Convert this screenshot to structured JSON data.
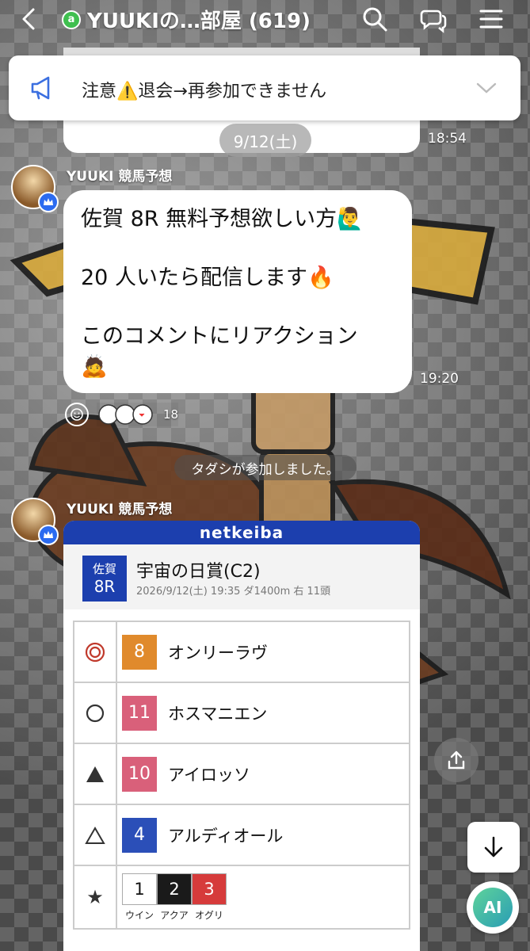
{
  "header": {
    "title": "YUUKIの…部屋 (619)",
    "badge_icon": "chat-room-icon"
  },
  "notice": {
    "text": "注意⚠️退会→再参加できません",
    "icon": "megaphone-icon"
  },
  "date_separator": "9/12(土)",
  "prev_message_time": "18:54",
  "message1": {
    "sender": "YUUKI 競馬予想",
    "line1": "佐賀 8R 無料予想欲しい方🙋‍♂️",
    "line2": "20 人いたら配信します🔥",
    "line3": "このコメントにリアクション",
    "line4": "🙇",
    "time": "19:20",
    "reaction_count": "18"
  },
  "system_message": "タダシが参加しました。",
  "message2": {
    "sender": "YUUKI 競馬予想",
    "card": {
      "brand": "netkeiba",
      "venue": "佐賀",
      "race_no": "8R",
      "race_title": "宇宙の日賞(C2)",
      "race_meta": "2026/9/12(土) 19:35 ダ1400m 右 11頭",
      "picks": [
        {
          "mark": "◎",
          "num": "8",
          "name": "オンリーラヴ",
          "color": "#e08a2c"
        },
        {
          "mark": "○",
          "num": "11",
          "name": "ホスマニエン",
          "color": "#d9607a"
        },
        {
          "mark": "▲",
          "num": "10",
          "name": "アイロッソ",
          "color": "#d9607a"
        },
        {
          "mark": "△",
          "num": "4",
          "name": "アルディオール",
          "color": "#2b4fb8"
        }
      ],
      "ticket": {
        "mark": "★",
        "boxes": [
          "1",
          "2",
          "3"
        ],
        "labels": [
          "ウイン",
          "アクア",
          "オグリ"
        ]
      }
    }
  },
  "buttons": {
    "ai_label": "AI"
  }
}
